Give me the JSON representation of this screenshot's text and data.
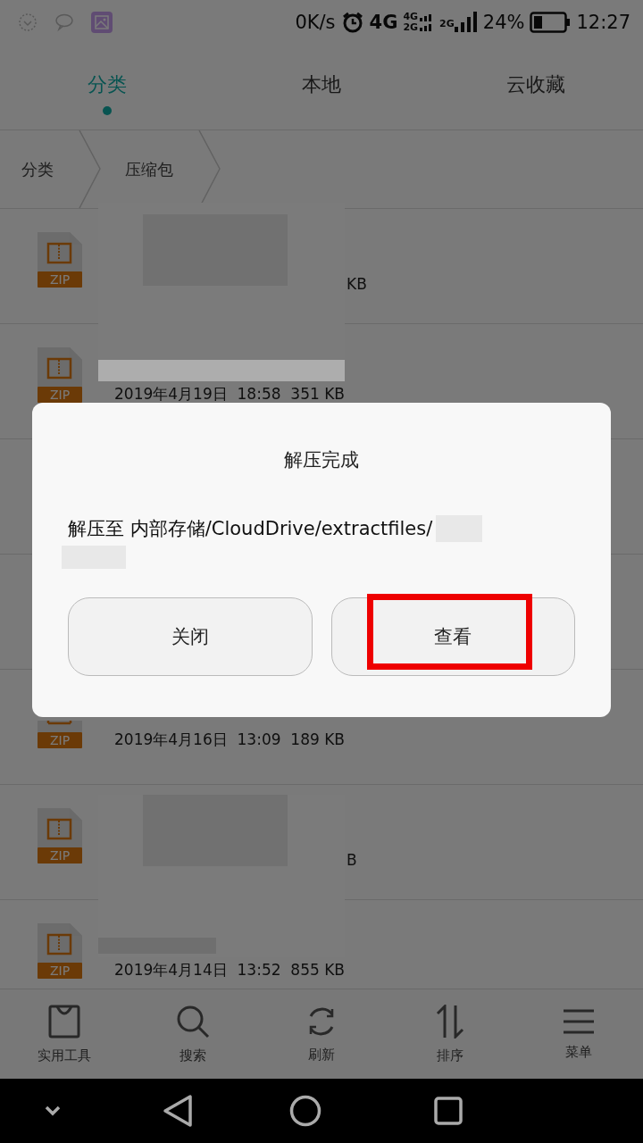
{
  "status_bar": {
    "speed": "0K/s",
    "network": "4G",
    "network_sub": "4G",
    "network_sub2": "2G",
    "network_third": "2G",
    "battery": "24%",
    "time": "12:27"
  },
  "tabs": [
    {
      "label": "分类",
      "selected": true
    },
    {
      "label": "本地",
      "selected": false
    },
    {
      "label": "云收藏",
      "selected": false
    }
  ],
  "breadcrumb": [
    "分类",
    "压缩包"
  ],
  "files": [
    {
      "kind": "obscured",
      "badge": "ZIP",
      "meta": "KB"
    },
    {
      "kind": "full",
      "badge": "ZIP",
      "meta": "2019年4月19日  18:58  351 KB"
    },
    {
      "kind": "hidden"
    },
    {
      "kind": "hidden"
    },
    {
      "kind": "covered",
      "badge": "ZIP",
      "meta": "2019年4月16日  13:09  189 KB"
    },
    {
      "kind": "obscured",
      "badge": "ZIP",
      "meta": "B"
    },
    {
      "kind": "full",
      "badge": "ZIP",
      "meta": "2019年4月14日  13:52  855 KB"
    }
  ],
  "toolbar": [
    {
      "kind": "tools",
      "label": "实用工具"
    },
    {
      "kind": "search",
      "label": "搜索"
    },
    {
      "kind": "refresh",
      "label": "刷新"
    },
    {
      "kind": "sort",
      "label": "排序"
    },
    {
      "kind": "menu",
      "label": "菜单"
    }
  ],
  "dialog": {
    "title": "解压完成",
    "message": "解压至 内部存储/CloudDrive/extractfiles/",
    "buttons": [
      {
        "label": "关闭",
        "highlighted": false
      },
      {
        "label": "查看",
        "highlighted": true
      }
    ]
  }
}
